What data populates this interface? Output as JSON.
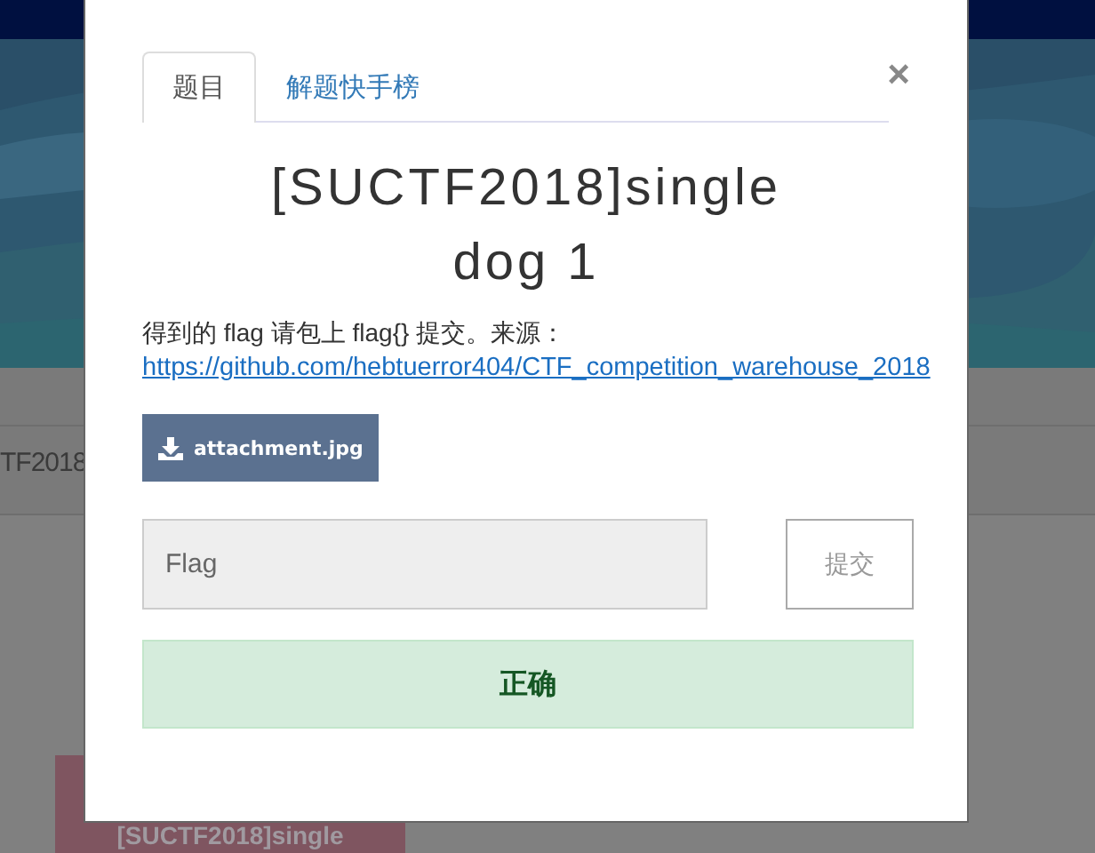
{
  "background": {
    "band_text": "TF2018",
    "card_title": "[SUCTF2018]single"
  },
  "modal": {
    "tabs": [
      {
        "label": "题目",
        "selected": true
      },
      {
        "label": "解题快手榜",
        "selected": false
      }
    ],
    "close": "×",
    "title": "[SUCTF2018]single dog 1",
    "description": "得到的 flag 请包上 flag{} 提交。来源：",
    "link": "https://github.com/hebtuerror404/CTF_competition_warehouse_2018",
    "attachment": "attachment.jpg",
    "flag_field": {
      "placeholder": "Flag"
    },
    "submit": "提交",
    "result": {
      "kind": "success",
      "text": "正确"
    }
  }
}
